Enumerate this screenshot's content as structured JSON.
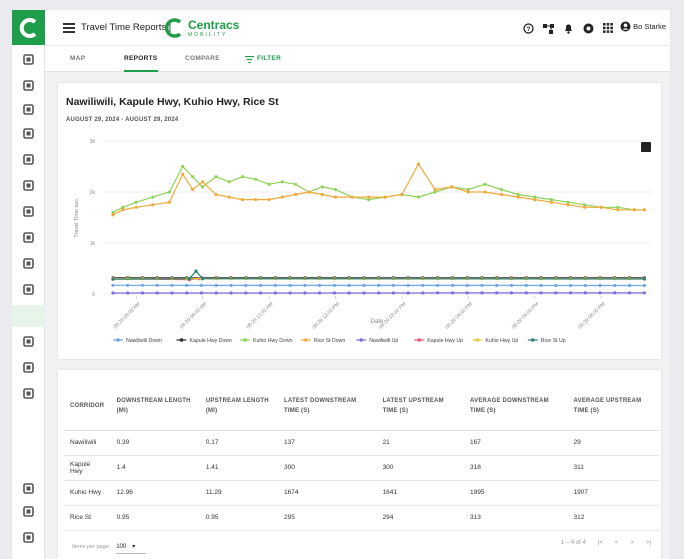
{
  "app": {
    "title": "Travel Time Reports |",
    "brand_name": "Centracs",
    "brand_sub": "MOBILITY",
    "user_name": "Bo Starke"
  },
  "tabs": [
    {
      "label": "MAP",
      "active": false
    },
    {
      "label": "REPORTS",
      "active": true
    },
    {
      "label": "COMPARE",
      "active": false
    },
    {
      "label": "FILTER",
      "active": false
    }
  ],
  "rail_icons": [
    "dashboard-icon",
    "map-icon",
    "signal-icon",
    "reports-icon",
    "swap-icon",
    "chart-icon",
    "crop-icon",
    "devices-icon",
    "satellite-icon",
    "bar-chart-icon",
    "travel-time-icon",
    "image-icon",
    "clock-icon",
    "edit-icon",
    "grid-icon",
    "settings-icon",
    "logout-icon"
  ],
  "colors": {
    "brand": "#1e9e4a",
    "nawiliwili_down": "#6fa8e8",
    "kapule_down": "#2b2b2b",
    "kuhio_down": "#8fd35a",
    "rice_down": "#f2a93b",
    "nawiliwili_up": "#7b6fe0",
    "kapule_up": "#e8557d",
    "kuhio_up": "#e6cc3a",
    "rice_up": "#2a7f7a"
  },
  "chart_data": {
    "type": "line",
    "title": "Nawiliwili, Kapule Hwy, Kuhio Hwy, Rice St",
    "subtitle": "AUGUST 29, 2024 - AUGUST 29, 2024",
    "xlabel": "Date",
    "ylabel": "Travel Time sec.",
    "ylim": [
      0,
      3000
    ],
    "yticks": [
      "0",
      "1k",
      "2k",
      "3k"
    ],
    "xtick_labels": [
      "08-29 06:00 AM",
      "08-29 08:00 AM",
      "08-29 10:00 AM",
      "08-29 12:00 PM",
      "08-29 02:00 PM",
      "08-29 04:00 PM",
      "08-29 06:00 PM",
      "08-29 08:00 PM"
    ],
    "x_range_hours": [
      5.0,
      21.5
    ],
    "legend_position": "bottom",
    "series": [
      {
        "name": "Nawiliwili Down",
        "color_key": "nawiliwili_down",
        "x": [
          5.3,
          21.3
        ],
        "values": [
          170,
          167
        ]
      },
      {
        "name": "Kapule Hwy Down",
        "color_key": "kapule_down",
        "x": [
          5.3,
          21.3
        ],
        "values": [
          315,
          318
        ]
      },
      {
        "name": "Kuhio Hwy Down",
        "color_key": "kuhio_down",
        "x": [
          5.3,
          5.6,
          6.0,
          6.5,
          7.0,
          7.4,
          7.7,
          8.0,
          8.4,
          8.8,
          9.2,
          9.6,
          10.0,
          10.4,
          10.8,
          11.2,
          11.6,
          12.0,
          12.5,
          13.0,
          13.5,
          14.0,
          14.5,
          15.0,
          15.5,
          16.0,
          16.5,
          17.0,
          17.5,
          18.0,
          18.5,
          19.0,
          19.5,
          20.0,
          20.5,
          21.0,
          21.3
        ],
        "values": [
          1600,
          1700,
          1800,
          1900,
          2000,
          2500,
          2300,
          2100,
          2300,
          2200,
          2300,
          2250,
          2150,
          2200,
          2150,
          2000,
          2100,
          2050,
          1900,
          1850,
          1900,
          1950,
          1900,
          2000,
          2100,
          2050,
          2150,
          2050,
          1950,
          1900,
          1850,
          1800,
          1750,
          1700,
          1700,
          1650,
          1650
        ]
      },
      {
        "name": "Rice St Down",
        "color_key": "rice_down",
        "x": [
          5.3,
          5.6,
          6.0,
          6.5,
          7.0,
          7.4,
          7.7,
          8.0,
          8.4,
          8.8,
          9.2,
          9.6,
          10.0,
          10.4,
          10.8,
          11.2,
          11.6,
          12.0,
          12.5,
          13.0,
          13.5,
          14.0,
          14.5,
          15.0,
          15.5,
          16.0,
          16.5,
          17.0,
          17.5,
          18.0,
          18.5,
          19.0,
          19.5,
          20.0,
          20.5,
          21.0,
          21.3
        ],
        "values": [
          1550,
          1650,
          1700,
          1750,
          1800,
          2350,
          2050,
          2200,
          1950,
          1900,
          1850,
          1850,
          1850,
          1900,
          1950,
          2000,
          1950,
          1900,
          1900,
          1900,
          1900,
          1950,
          2550,
          2050,
          2100,
          2000,
          2000,
          1950,
          1900,
          1850,
          1800,
          1750,
          1700,
          1700,
          1650,
          1650,
          1650
        ]
      },
      {
        "name": "Nawiliwili Up",
        "color_key": "nawiliwili_up",
        "x": [
          5.3,
          21.3
        ],
        "values": [
          20,
          21
        ]
      },
      {
        "name": "Kapule Hwy Up",
        "color_key": "kapule_up",
        "x": [
          5.3,
          7.6,
          7.9,
          21.3
        ],
        "values": [
          300,
          280,
          300,
          300
        ]
      },
      {
        "name": "Kuhio Hwy Up",
        "color_key": "kuhio_up",
        "x": [
          5.3,
          21.3
        ],
        "values": [
          300,
          300
        ]
      },
      {
        "name": "Rice St Up",
        "color_key": "rice_up",
        "x": [
          5.3,
          7.6,
          7.8,
          8.0,
          21.3
        ],
        "values": [
          290,
          300,
          450,
          300,
          294
        ]
      }
    ]
  },
  "table": {
    "headers": [
      "CORRIDOR",
      "DOWNSTREAM LENGTH (MI)",
      "UPSTREAM LENGTH (MI)",
      "LATEST DOWNSTREAM TIME (S)",
      "LATEST UPSTREAM TIME (S)",
      "AVERAGE DOWNSTREAM TIME (S)",
      "AVERAGE UPSTREAM TIME (S)"
    ],
    "rows": [
      [
        "Nawiliwili",
        "0.39",
        "0.17",
        "137",
        "21",
        "167",
        "29"
      ],
      [
        "Kapule Hwy",
        "1.4",
        "1.41",
        "300",
        "300",
        "318",
        "311"
      ],
      [
        "Kuhio Hwy",
        "12.96",
        "11.29",
        "1674",
        "1641",
        "1995",
        "1907"
      ],
      [
        "Rice St",
        "0.95",
        "0.95",
        "295",
        "294",
        "313",
        "312"
      ]
    ]
  },
  "pager": {
    "label": "Items per page:",
    "value": "100",
    "range": "1 – 4 of 4"
  }
}
